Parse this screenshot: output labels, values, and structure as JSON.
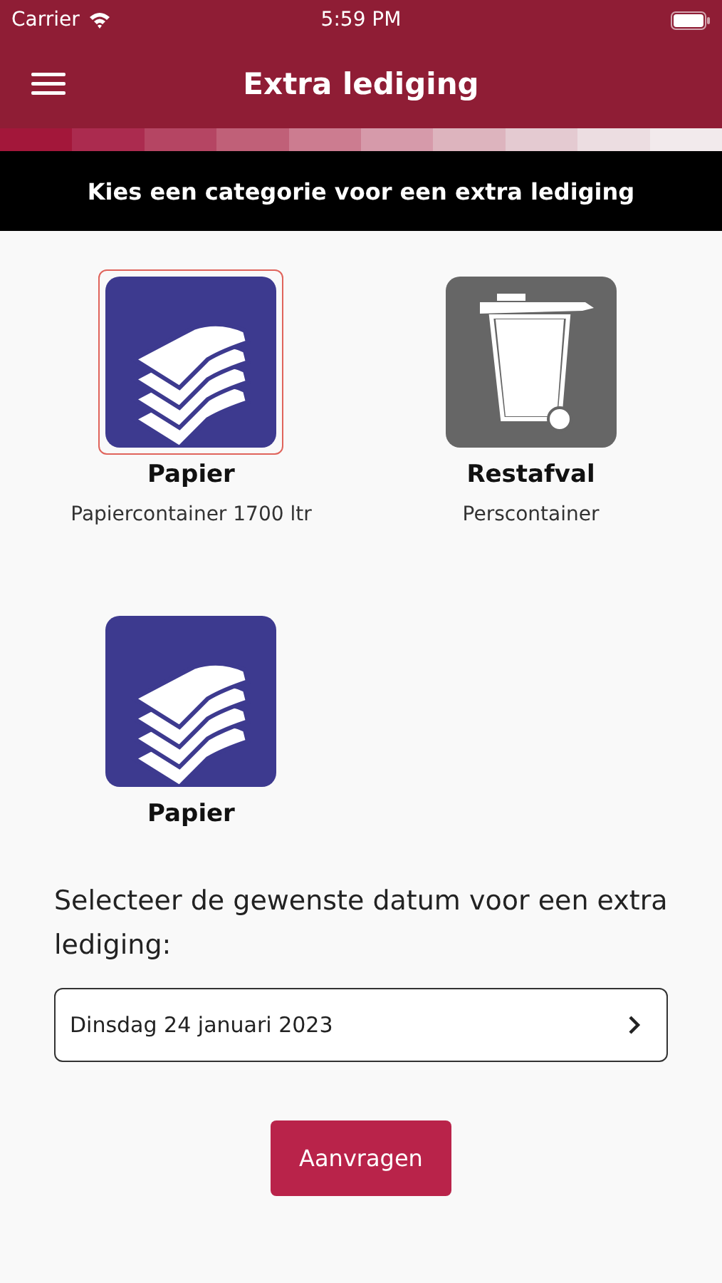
{
  "status_bar": {
    "carrier": "Carrier",
    "time": "5:59 PM"
  },
  "nav_bar": {
    "title": "Extra lediging"
  },
  "banner": "Kies een categorie voor een extra lediging",
  "categories": [
    {
      "kind": "paper",
      "color": "#3d3a8f",
      "title": "Papier",
      "subtitle": "Papiercontainer 1700 ltr",
      "selected": true
    },
    {
      "kind": "bin",
      "color": "#666666",
      "title": "Restafval",
      "subtitle": "Perscontainer",
      "selected": false
    },
    {
      "kind": "paper",
      "color": "#3d3a8f",
      "title": "Papier",
      "selected": false
    }
  ],
  "date_prompt": "Selecteer de gewenste datum voor een extra lediging:",
  "date_field": {
    "value": "Dinsdag 24 januari 2023"
  },
  "submit_button": "Aanvragen"
}
